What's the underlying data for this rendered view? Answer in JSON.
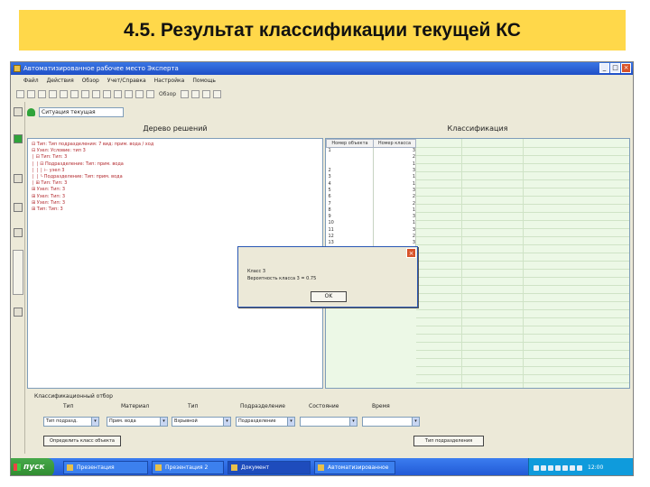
{
  "slide": {
    "title": "4.5. Результат классификации текущей КС"
  },
  "window": {
    "title": "Автоматизированное рабочее место Эксперта",
    "controls": [
      "_",
      "□",
      "×"
    ]
  },
  "menu": [
    "Файл",
    "Действия",
    "Обзор",
    "Учет/Справка",
    "Настройка",
    "Помощь"
  ],
  "toolbar": {
    "label": "Обзор"
  },
  "inner_bar": {
    "field_value": "Ситуация текущая"
  },
  "tree_panel": {
    "header": "Дерево решений",
    "nodes": [
      "⊟ Тип: Тип подразделения: 7 вид: прим. вода / ход",
      "   ⊟ Узел: Условие: тип 3",
      "   │  ⊟ Тип: Тип: 3",
      "   │  │  ⊟ Подразделение: Тип: прим. вода",
      "   │  │  │     ⊢ узел 3",
      "   │  │  └ Подразделение: Тип: прим. вода",
      "   │  ⊞ Тип: Тип: 3",
      "   ⊞ Узел: Тип: 3",
      "   ⊞ Узел: Тип: 3",
      "   ⊞ Узел: Тип: 3",
      "⊞ Тип: Тип: 3"
    ]
  },
  "class_panel": {
    "header": "Классификация",
    "columns": [
      "Номер объекта",
      "Номер класса"
    ],
    "rows": [
      [
        "1",
        "3"
      ],
      [
        "",
        "2"
      ],
      [
        "",
        "1"
      ],
      [
        "2",
        "3"
      ],
      [
        "3",
        "1"
      ],
      [
        "4",
        "1"
      ],
      [
        "5",
        "3"
      ],
      [
        "6",
        "2"
      ],
      [
        "7",
        "2"
      ],
      [
        "8",
        "1"
      ],
      [
        "9",
        "3"
      ],
      [
        "10",
        "1"
      ],
      [
        "11",
        "3"
      ],
      [
        "12",
        "2"
      ],
      [
        "13",
        "3"
      ]
    ]
  },
  "dialog": {
    "title": "Класс 3",
    "text": "Вероятность класса 3 = 0.75",
    "ok_label": "OK"
  },
  "filter": {
    "title": "Классификационный отбор",
    "labels": [
      "Тип",
      "Материал",
      "Тип",
      "Подразделение",
      "Состояние",
      "Время"
    ],
    "values": [
      "Тип подразд.",
      "Прим. вода",
      "Взрывной",
      "Подразделение",
      "",
      ""
    ],
    "left_button": "Определить класс объекта",
    "right_button": "Тип подразделения"
  },
  "taskbar": {
    "start_label": "пуск",
    "tasks": [
      "Презентация",
      "Презентация 2",
      "Документ",
      "Автоматизированное"
    ],
    "time": "12:00"
  }
}
